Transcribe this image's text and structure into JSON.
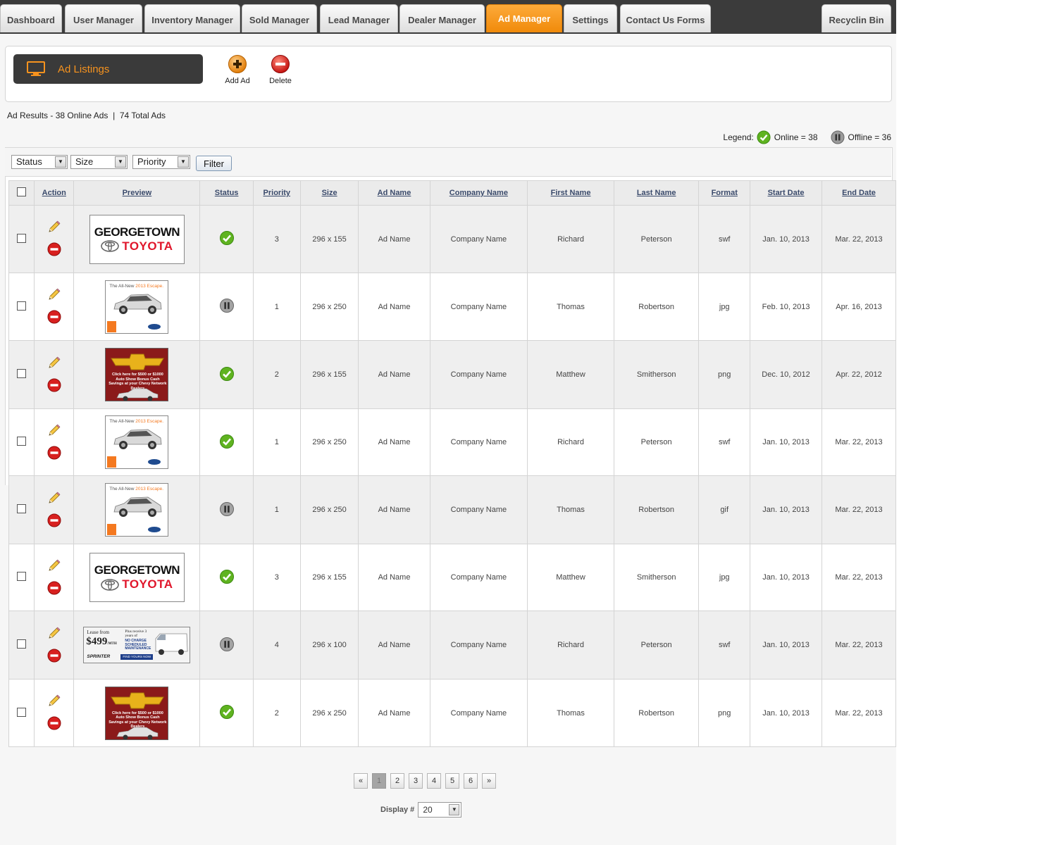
{
  "tabs": [
    {
      "label": "Dashboard",
      "active": false
    },
    {
      "label": "User Manager",
      "active": false
    },
    {
      "label": "Inventory Manager",
      "active": false
    },
    {
      "label": "Sold Manager",
      "active": false
    },
    {
      "label": "Lead Manager",
      "active": false
    },
    {
      "label": "Dealer Manager",
      "active": false
    },
    {
      "label": "Ad Manager",
      "active": true
    },
    {
      "label": "Settings",
      "active": false
    },
    {
      "label": "Contact Us Forms",
      "active": false
    }
  ],
  "recycle_tab": "Recyclin Bin",
  "header": {
    "title": "Ad Listings",
    "title_icon": "monitor-icon",
    "add_label": "Add Ad",
    "delete_label": "Delete"
  },
  "results_text": "Ad Results - 38 Online Ads  |  74 Total Ads",
  "legend": {
    "label": "Legend:",
    "online": "Online = 38",
    "offline": "Offline = 36"
  },
  "filters": {
    "status": "Status",
    "size": "Size",
    "priority": "Priority",
    "button": "Filter"
  },
  "columns": [
    "Action",
    "Preview",
    "Status",
    "Priority",
    "Size",
    "Ad Name",
    "Company Name",
    "First Name",
    "Last Name",
    "Format",
    "Start Date",
    "End Date"
  ],
  "rows": [
    {
      "preview": "toyota",
      "status": "online",
      "priority": "3",
      "size": "296 x 155",
      "ad_name": "Ad Name",
      "company": "Company Name",
      "first": "Richard",
      "last": "Peterson",
      "format": "swf",
      "start": "Jan. 10, 2013",
      "end": "Mar. 22, 2013"
    },
    {
      "preview": "escape",
      "status": "offline",
      "priority": "1",
      "size": "296 x 250",
      "ad_name": "Ad Name",
      "company": "Company Name",
      "first": "Thomas",
      "last": "Robertson",
      "format": "jpg",
      "start": "Feb. 10, 2013",
      "end": "Apr. 16, 2013"
    },
    {
      "preview": "chevy",
      "status": "online",
      "priority": "2",
      "size": "296 x 155",
      "ad_name": "Ad Name",
      "company": "Company Name",
      "first": "Matthew",
      "last": "Smitherson",
      "format": "png",
      "start": "Dec. 10, 2012",
      "end": "Apr. 22, 2012"
    },
    {
      "preview": "escape",
      "status": "online",
      "priority": "1",
      "size": "296 x 250",
      "ad_name": "Ad Name",
      "company": "Company Name",
      "first": "Richard",
      "last": "Peterson",
      "format": "swf",
      "start": "Jan. 10, 2013",
      "end": "Mar. 22, 2013"
    },
    {
      "preview": "escape",
      "status": "offline",
      "priority": "1",
      "size": "296 x 250",
      "ad_name": "Ad Name",
      "company": "Company Name",
      "first": "Thomas",
      "last": "Robertson",
      "format": "gif",
      "start": "Jan. 10, 2013",
      "end": "Mar. 22, 2013"
    },
    {
      "preview": "toyota",
      "status": "online",
      "priority": "3",
      "size": "296 x 155",
      "ad_name": "Ad Name",
      "company": "Company Name",
      "first": "Matthew",
      "last": "Smitherson",
      "format": "jpg",
      "start": "Jan. 10, 2013",
      "end": "Mar. 22, 2013"
    },
    {
      "preview": "sprinter",
      "status": "offline",
      "priority": "4",
      "size": "296 x 100",
      "ad_name": "Ad Name",
      "company": "Company Name",
      "first": "Richard",
      "last": "Peterson",
      "format": "swf",
      "start": "Jan. 10, 2013",
      "end": "Mar. 22, 2013"
    },
    {
      "preview": "chevy",
      "status": "online",
      "priority": "2",
      "size": "296 x 250",
      "ad_name": "Ad Name",
      "company": "Company Name",
      "first": "Thomas",
      "last": "Robertson",
      "format": "png",
      "start": "Jan. 10, 2013",
      "end": "Mar. 22, 2013"
    }
  ],
  "ads": {
    "toyota": {
      "line1": "GEORGETOWN",
      "line2": "TOYOTA"
    },
    "escape": {
      "head_a": "The All-New ",
      "head_b": "2013 Escape."
    },
    "chevy": {
      "text": "Click here for $500 or $1000 Auto Show Bonus Cash Savings at your Chevy Network Dealers"
    },
    "sprinter": {
      "lease": "Lease from",
      "price": "$499",
      "per": "/MTH",
      "plus": "Plus receive 3 years of",
      "maint": "NO CHARGE SCHEDULED MAINTENANCE",
      "brand": "SPRINTER",
      "cta": "FIND YOURS NOW"
    }
  },
  "pagination": {
    "prev": "«",
    "pages": [
      "1",
      "2",
      "3",
      "4",
      "5",
      "6"
    ],
    "current": "1",
    "next": "»",
    "display_label": "Display #",
    "display_value": "20"
  },
  "colors": {
    "accent": "#f7931e",
    "online": "#5fb320",
    "offline": "#888888",
    "delete": "#d8201f"
  }
}
